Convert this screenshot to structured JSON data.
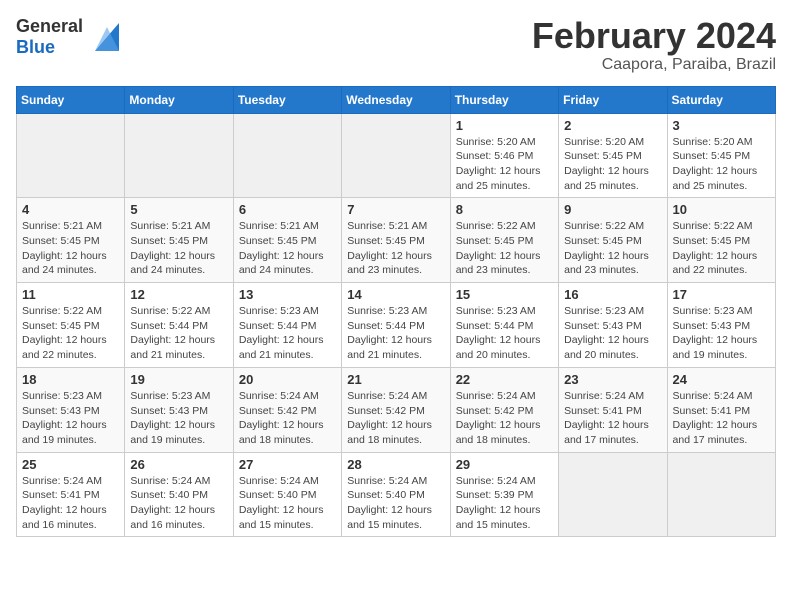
{
  "logo": {
    "general": "General",
    "blue": "Blue"
  },
  "title": {
    "month": "February 2024",
    "location": "Caapora, Paraiba, Brazil"
  },
  "weekdays": [
    "Sunday",
    "Monday",
    "Tuesday",
    "Wednesday",
    "Thursday",
    "Friday",
    "Saturday"
  ],
  "weeks": [
    [
      {
        "day": "",
        "detail": ""
      },
      {
        "day": "",
        "detail": ""
      },
      {
        "day": "",
        "detail": ""
      },
      {
        "day": "",
        "detail": ""
      },
      {
        "day": "1",
        "detail": "Sunrise: 5:20 AM\nSunset: 5:46 PM\nDaylight: 12 hours\nand 25 minutes."
      },
      {
        "day": "2",
        "detail": "Sunrise: 5:20 AM\nSunset: 5:45 PM\nDaylight: 12 hours\nand 25 minutes."
      },
      {
        "day": "3",
        "detail": "Sunrise: 5:20 AM\nSunset: 5:45 PM\nDaylight: 12 hours\nand 25 minutes."
      }
    ],
    [
      {
        "day": "4",
        "detail": "Sunrise: 5:21 AM\nSunset: 5:45 PM\nDaylight: 12 hours\nand 24 minutes."
      },
      {
        "day": "5",
        "detail": "Sunrise: 5:21 AM\nSunset: 5:45 PM\nDaylight: 12 hours\nand 24 minutes."
      },
      {
        "day": "6",
        "detail": "Sunrise: 5:21 AM\nSunset: 5:45 PM\nDaylight: 12 hours\nand 24 minutes."
      },
      {
        "day": "7",
        "detail": "Sunrise: 5:21 AM\nSunset: 5:45 PM\nDaylight: 12 hours\nand 23 minutes."
      },
      {
        "day": "8",
        "detail": "Sunrise: 5:22 AM\nSunset: 5:45 PM\nDaylight: 12 hours\nand 23 minutes."
      },
      {
        "day": "9",
        "detail": "Sunrise: 5:22 AM\nSunset: 5:45 PM\nDaylight: 12 hours\nand 23 minutes."
      },
      {
        "day": "10",
        "detail": "Sunrise: 5:22 AM\nSunset: 5:45 PM\nDaylight: 12 hours\nand 22 minutes."
      }
    ],
    [
      {
        "day": "11",
        "detail": "Sunrise: 5:22 AM\nSunset: 5:45 PM\nDaylight: 12 hours\nand 22 minutes."
      },
      {
        "day": "12",
        "detail": "Sunrise: 5:22 AM\nSunset: 5:44 PM\nDaylight: 12 hours\nand 21 minutes."
      },
      {
        "day": "13",
        "detail": "Sunrise: 5:23 AM\nSunset: 5:44 PM\nDaylight: 12 hours\nand 21 minutes."
      },
      {
        "day": "14",
        "detail": "Sunrise: 5:23 AM\nSunset: 5:44 PM\nDaylight: 12 hours\nand 21 minutes."
      },
      {
        "day": "15",
        "detail": "Sunrise: 5:23 AM\nSunset: 5:44 PM\nDaylight: 12 hours\nand 20 minutes."
      },
      {
        "day": "16",
        "detail": "Sunrise: 5:23 AM\nSunset: 5:43 PM\nDaylight: 12 hours\nand 20 minutes."
      },
      {
        "day": "17",
        "detail": "Sunrise: 5:23 AM\nSunset: 5:43 PM\nDaylight: 12 hours\nand 19 minutes."
      }
    ],
    [
      {
        "day": "18",
        "detail": "Sunrise: 5:23 AM\nSunset: 5:43 PM\nDaylight: 12 hours\nand 19 minutes."
      },
      {
        "day": "19",
        "detail": "Sunrise: 5:23 AM\nSunset: 5:43 PM\nDaylight: 12 hours\nand 19 minutes."
      },
      {
        "day": "20",
        "detail": "Sunrise: 5:24 AM\nSunset: 5:42 PM\nDaylight: 12 hours\nand 18 minutes."
      },
      {
        "day": "21",
        "detail": "Sunrise: 5:24 AM\nSunset: 5:42 PM\nDaylight: 12 hours\nand 18 minutes."
      },
      {
        "day": "22",
        "detail": "Sunrise: 5:24 AM\nSunset: 5:42 PM\nDaylight: 12 hours\nand 18 minutes."
      },
      {
        "day": "23",
        "detail": "Sunrise: 5:24 AM\nSunset: 5:41 PM\nDaylight: 12 hours\nand 17 minutes."
      },
      {
        "day": "24",
        "detail": "Sunrise: 5:24 AM\nSunset: 5:41 PM\nDaylight: 12 hours\nand 17 minutes."
      }
    ],
    [
      {
        "day": "25",
        "detail": "Sunrise: 5:24 AM\nSunset: 5:41 PM\nDaylight: 12 hours\nand 16 minutes."
      },
      {
        "day": "26",
        "detail": "Sunrise: 5:24 AM\nSunset: 5:40 PM\nDaylight: 12 hours\nand 16 minutes."
      },
      {
        "day": "27",
        "detail": "Sunrise: 5:24 AM\nSunset: 5:40 PM\nDaylight: 12 hours\nand 15 minutes."
      },
      {
        "day": "28",
        "detail": "Sunrise: 5:24 AM\nSunset: 5:40 PM\nDaylight: 12 hours\nand 15 minutes."
      },
      {
        "day": "29",
        "detail": "Sunrise: 5:24 AM\nSunset: 5:39 PM\nDaylight: 12 hours\nand 15 minutes."
      },
      {
        "day": "",
        "detail": ""
      },
      {
        "day": "",
        "detail": ""
      }
    ]
  ]
}
